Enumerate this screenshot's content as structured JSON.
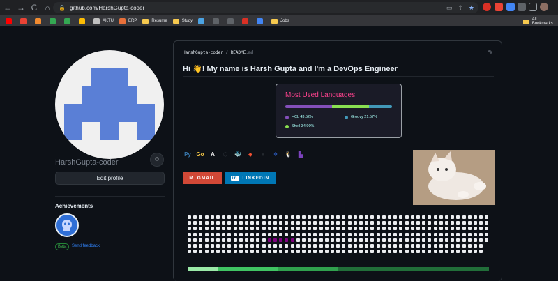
{
  "browser": {
    "url": "github.com/HarshGupta-coder",
    "nav": {
      "back": "←",
      "forward": "→",
      "reload": "C",
      "home": "⌂"
    },
    "bookmarks": [
      {
        "label": "",
        "icon": "youtube-icon",
        "color": "#ff0000"
      },
      {
        "label": "",
        "icon": "gmail-icon",
        "color": "#ea4335"
      },
      {
        "label": "",
        "icon": "x-icon",
        "color": "#f28b30"
      },
      {
        "label": "",
        "icon": "leaf-icon",
        "color": "#34a853"
      },
      {
        "label": "",
        "icon": "leaf2-icon",
        "color": "#34a853"
      },
      {
        "label": "",
        "icon": "browser-icon",
        "color": "#fbbc04"
      },
      {
        "label": "AKTU",
        "icon": "aktu-icon",
        "color": "#c0c0c0"
      },
      {
        "label": "ERP",
        "icon": "erp-icon",
        "color": "#e8703a"
      },
      {
        "label": "Resume",
        "icon": "folder-icon",
        "color": "#f6c94f"
      },
      {
        "label": "Study",
        "icon": "folder-icon",
        "color": "#f6c94f"
      },
      {
        "label": "",
        "icon": "site-icon",
        "color": "#4ba3e3"
      },
      {
        "label": "",
        "icon": "site2-icon",
        "color": "#5f6368"
      },
      {
        "label": "",
        "icon": "site3-icon",
        "color": "#5f6368"
      },
      {
        "label": "",
        "icon": "site4-icon",
        "color": "#d93025"
      },
      {
        "label": "",
        "icon": "site5-icon",
        "color": "#4285f4"
      },
      {
        "label": "Jobs",
        "icon": "folder-icon",
        "color": "#f6c94f"
      }
    ],
    "all_bookmarks": "All Bookmarks"
  },
  "profile": {
    "username": "HarshGupta-coder",
    "edit_label": "Edit profile",
    "achievements_title": "Achievements",
    "beta": "Beta",
    "feedback": "Send feedback",
    "status_icon": "☺"
  },
  "readme": {
    "owner": "HarshGupta-coder",
    "sep": " / ",
    "file": "README",
    "ext": ".md",
    "heading": "Hi 👋! My name is Harsh Gupta and I'm a DevOps Engineer",
    "edit_icon": "✎"
  },
  "languages": {
    "title": "Most Used Languages",
    "items": [
      {
        "name": "HCL 43.52%",
        "color": "#844fba",
        "value": 43.52
      },
      {
        "name": "Groovy 21.57%",
        "color": "#4298b8",
        "value": 21.57
      },
      {
        "name": "Shell 34.90%",
        "color": "#89e051",
        "value": 34.9
      }
    ]
  },
  "tech_icons": [
    {
      "name": "python-icon",
      "label": "Py",
      "color": "#3776ab"
    },
    {
      "name": "golang-icon",
      "label": "Go",
      "color": "#f7c948"
    },
    {
      "name": "ansible-icon",
      "label": "A",
      "color": "#ffffff"
    },
    {
      "name": "aws-icon",
      "label": "⬡",
      "color": "#30363d"
    },
    {
      "name": "docker-icon",
      "label": "🐳",
      "color": "#2496ed"
    },
    {
      "name": "git-icon",
      "label": "◆",
      "color": "#f05032"
    },
    {
      "name": "github-icon",
      "label": "●",
      "color": "#24292f"
    },
    {
      "name": "kubernetes-icon",
      "label": "✲",
      "color": "#326ce5"
    },
    {
      "name": "linux-icon",
      "label": "🐧",
      "color": "#ffffff"
    },
    {
      "name": "terraform-icon",
      "label": "▙",
      "color": "#7b42bc"
    }
  ],
  "social": {
    "gmail": "GMAIL",
    "linkedin": "LINKEDIN"
  },
  "snake": {
    "cols": 53,
    "rows": 7,
    "snake_color": "#800080"
  },
  "progress_colors": [
    "#9be9a8",
    "#40c463",
    "#30a14e",
    "#216e39"
  ]
}
